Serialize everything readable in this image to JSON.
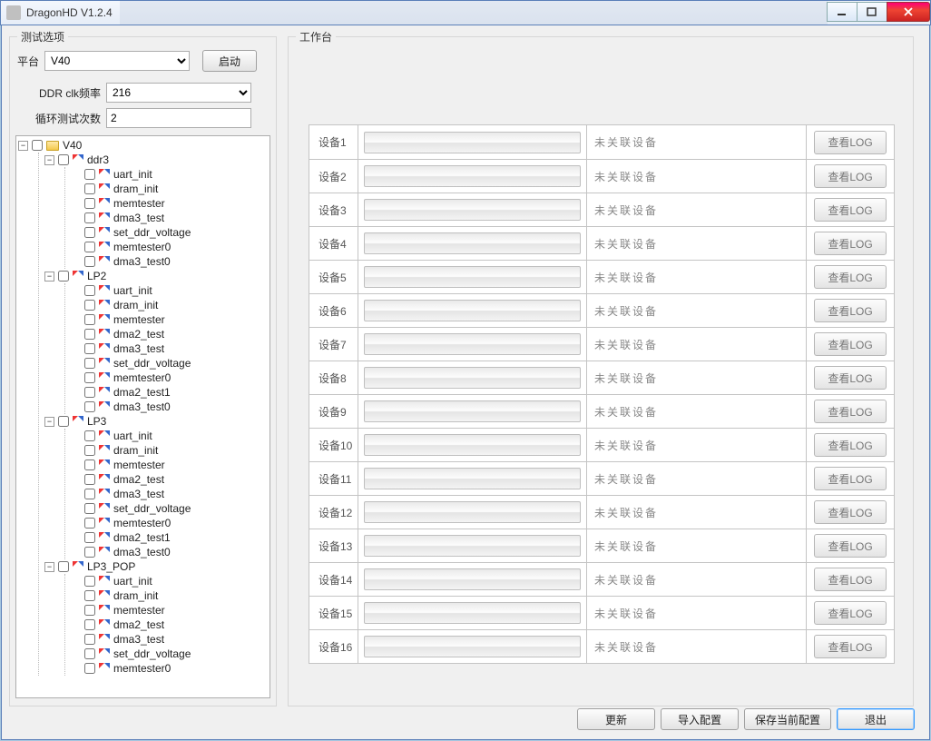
{
  "window": {
    "title": "DragonHD V1.2.4"
  },
  "leftPanel": {
    "title": "测试选项",
    "platformLabel": "平台",
    "platformValue": "V40",
    "startButton": "启动",
    "ddrLabel": "DDR clk频率",
    "ddrValue": "216",
    "loopLabel": "循环测试次数",
    "loopValue": "2"
  },
  "tree": {
    "root": {
      "label": "V40"
    },
    "groups": [
      {
        "label": "ddr3",
        "items": [
          "uart_init",
          "dram_init",
          "memtester",
          "dma3_test",
          "set_ddr_voltage",
          "memtester0",
          "dma3_test0"
        ]
      },
      {
        "label": "LP2",
        "items": [
          "uart_init",
          "dram_init",
          "memtester",
          "dma2_test",
          "dma3_test",
          "set_ddr_voltage",
          "memtester0",
          "dma2_test1",
          "dma3_test0"
        ]
      },
      {
        "label": "LP3",
        "items": [
          "uart_init",
          "dram_init",
          "memtester",
          "dma2_test",
          "dma3_test",
          "set_ddr_voltage",
          "memtester0",
          "dma2_test1",
          "dma3_test0"
        ]
      },
      {
        "label": "LP3_POP",
        "items": [
          "uart_init",
          "dram_init",
          "memtester",
          "dma2_test",
          "dma3_test",
          "set_ddr_voltage",
          "memtester0"
        ]
      }
    ]
  },
  "rightPanel": {
    "title": "工作台",
    "devicePrefix": "设备",
    "deviceCount": 16,
    "status": "未关联设备",
    "logButton": "查看LOG"
  },
  "bottom": {
    "refresh": "更新",
    "import": "导入配置",
    "save": "保存当前配置",
    "exit": "退出"
  }
}
